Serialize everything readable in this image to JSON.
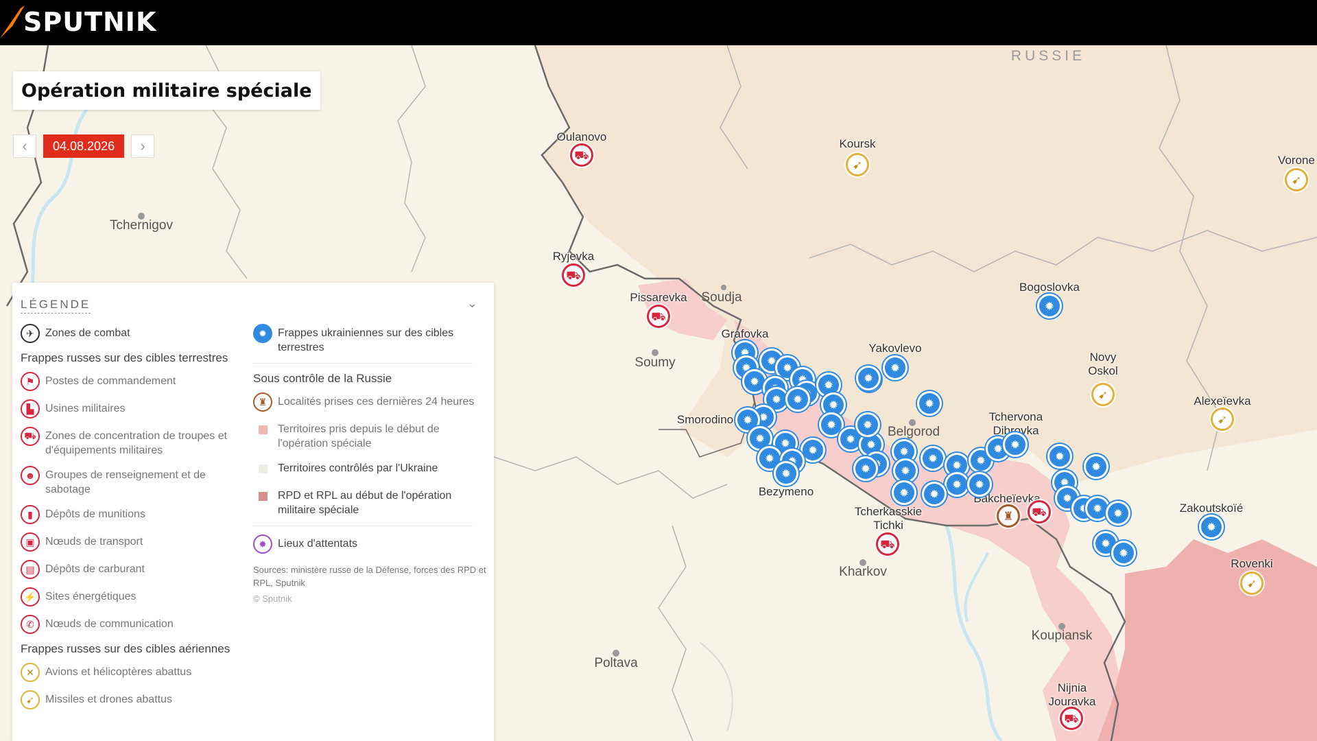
{
  "header": {
    "brand": "SPUTNIK"
  },
  "title": "Opération militaire spéciale",
  "date_nav": {
    "prev": "‹",
    "date": "04.08.2026",
    "next": "›"
  },
  "map": {
    "places": [
      {
        "id": "tchernigov",
        "label": "Tchernigov"
      },
      {
        "id": "soumy",
        "label": "Soumy"
      },
      {
        "id": "poltava",
        "label": "Poltava"
      },
      {
        "id": "kharkov",
        "label": "Kharkov"
      },
      {
        "id": "koupiansk",
        "label": "Koupiansk"
      },
      {
        "id": "belgorod",
        "label": "Belgorod"
      },
      {
        "id": "soudja",
        "label": "Soudja"
      },
      {
        "id": "koursk",
        "label": "Koursk"
      },
      {
        "id": "vorone",
        "label": "Vorone"
      },
      {
        "id": "oulanovo",
        "label": "Oulanovo"
      },
      {
        "id": "ryjevka",
        "label": "Ryjevka"
      },
      {
        "id": "pissarevka",
        "label": "Pissarevka"
      },
      {
        "id": "grafovka",
        "label": "Grafovka"
      },
      {
        "id": "smorodino",
        "label": "Smorodino"
      },
      {
        "id": "bezymeno",
        "label": "Bezymeno"
      },
      {
        "id": "yakovlevo",
        "label": "Yakovlevo"
      },
      {
        "id": "bogoslovka",
        "label": "Bogoslovka"
      },
      {
        "id": "novy_oskol",
        "label": "Novy Oskol"
      },
      {
        "id": "alexeievka",
        "label": "Alexeïevka"
      },
      {
        "id": "tchervona",
        "label": "Tchervona Dibrovka"
      },
      {
        "id": "bakcheievka",
        "label": "Bakcheïevka"
      },
      {
        "id": "tcherkasskie",
        "label": "Tcherkasskie Tichki"
      },
      {
        "id": "zakoutskoie",
        "label": "Zakoutskoïé"
      },
      {
        "id": "rovenki",
        "label": "Rovenki"
      },
      {
        "id": "ninia",
        "label": "Nijnia Jouravka"
      },
      {
        "id": "russie",
        "label": "RUSSIE"
      }
    ],
    "colors": {
      "land": "#f7f3e8",
      "russia_land": "#f3e6d2",
      "pink_zone": "#f2b8b5",
      "pink_light": "#f6cfcc",
      "border": "#6b6b6b",
      "river": "#c9e5ef",
      "strike_blue": "#2f8ae0",
      "red_marker": "#d7263d",
      "yellow_marker": "#e0b13c"
    }
  },
  "legend": {
    "heading": "LÉGENDE",
    "collapse_icon": "chevron-down-icon",
    "left": [
      {
        "type": "item",
        "icon": "combat-icon",
        "style": "black",
        "glyph": "✈",
        "text": "Zones de combat",
        "dark": true
      },
      {
        "type": "section",
        "text": "Frappes russes sur des cibles terrestres"
      },
      {
        "type": "item",
        "icon": "flag-icon",
        "style": "red",
        "glyph": "⚑",
        "text": "Postes de commandement"
      },
      {
        "type": "item",
        "icon": "factory-icon",
        "style": "red",
        "glyph": "▙",
        "text": "Usines militaires"
      },
      {
        "type": "item",
        "icon": "truck-icon",
        "style": "red",
        "glyph": "⛟",
        "text": "Zones de concentration de troupes et d'équipements militaires"
      },
      {
        "type": "item",
        "icon": "group-icon",
        "style": "red",
        "glyph": "☻",
        "text": "Groupes de renseignement et de sabotage"
      },
      {
        "type": "item",
        "icon": "ammo-icon",
        "style": "red",
        "glyph": "▮",
        "text": "Dépôts de munitions"
      },
      {
        "type": "item",
        "icon": "train-icon",
        "style": "red",
        "glyph": "▣",
        "text": "Nœuds de transport"
      },
      {
        "type": "item",
        "icon": "fuel-icon",
        "style": "red",
        "glyph": "▤",
        "text": "Dépôts de carburant"
      },
      {
        "type": "item",
        "icon": "energy-icon",
        "style": "red",
        "glyph": "⚡",
        "text": "Sites énergétiques"
      },
      {
        "type": "item",
        "icon": "antenna-icon",
        "style": "red",
        "glyph": "✆",
        "text": "Nœuds de communication"
      },
      {
        "type": "section",
        "text": "Frappes russes sur des cibles aériennes"
      },
      {
        "type": "item",
        "icon": "plane-icon",
        "style": "yellow",
        "glyph": "✕",
        "text": "Avions et hélicoptères abattus"
      },
      {
        "type": "item",
        "icon": "missile-icon",
        "style": "yellow",
        "glyph": "➹",
        "text": "Missiles et drones abattus"
      }
    ],
    "right": [
      {
        "type": "item",
        "icon": "ukrainian-strike-icon",
        "style": "blue",
        "glyph": "✹",
        "text": "Frappes ukrainiennes sur des cibles terrestres",
        "dark": true
      },
      {
        "type": "sep"
      },
      {
        "type": "section",
        "text": "Sous contrôle de la Russie"
      },
      {
        "type": "item",
        "icon": "captured-locality-icon",
        "style": "brown",
        "glyph": "♜",
        "text": "Localités prises ces dernières 24 heures"
      },
      {
        "type": "swatch",
        "color": "#f2b8b5",
        "text": "Territoires pris depuis le début de l'opération spéciale"
      },
      {
        "type": "swatch",
        "color": "#eeeee4",
        "text": "Territoires contrôlés par l'Ukraine",
        "dark": true
      },
      {
        "type": "swatch",
        "color": "#d68d8d",
        "text": "RPD et RPL au début de l'opération militaire spéciale",
        "dark": true
      },
      {
        "type": "sep"
      },
      {
        "type": "item",
        "icon": "attack-icon",
        "style": "purple",
        "glyph": "✸",
        "text": "Lieux d'attentats",
        "dark": true
      }
    ],
    "sources": "Sources: ministère russe de la Défense, forces des RPD et RPL, Sputnik",
    "copyright": "© Sputnik"
  }
}
